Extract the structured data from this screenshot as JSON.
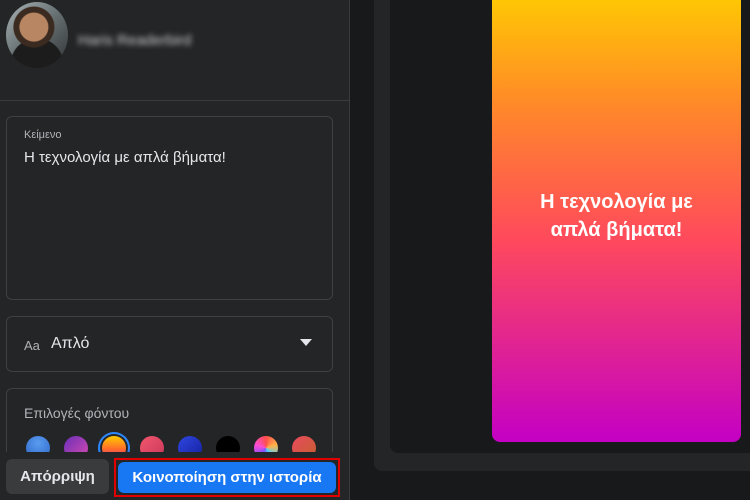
{
  "profile": {
    "name": "Haris Readerbird"
  },
  "text_field": {
    "caption": "Κείμενο",
    "value": "Η τεχνολογία με απλά βήματα!"
  },
  "font_select": {
    "icon_label": "Aa",
    "value": "Απλό"
  },
  "background": {
    "caption": "Επιλογές φόντου",
    "swatches": [
      {
        "name": "blue",
        "color": "#3b7ddd"
      },
      {
        "name": "purple-pink",
        "color": "#9b3fb3"
      },
      {
        "name": "orange-yellow",
        "color": "#ff8c1a",
        "selected": true
      },
      {
        "name": "pink-red",
        "color": "#e24a6a"
      },
      {
        "name": "dark-blue",
        "color": "#1e34c8"
      },
      {
        "name": "black",
        "color": "#000000"
      },
      {
        "name": "rainbow",
        "color": "#c040ff"
      },
      {
        "name": "red-orange",
        "color": "#d9534f"
      }
    ]
  },
  "buttons": {
    "discard": "Απόρριψη",
    "share": "Κοινοποίηση στην ιστορία"
  },
  "preview": {
    "text": "Η τεχνολογία με απλά βήματα!"
  },
  "colors": {
    "accent": "#1877f2",
    "highlight": "#e00000",
    "panel": "#242526",
    "background": "#18191a"
  }
}
